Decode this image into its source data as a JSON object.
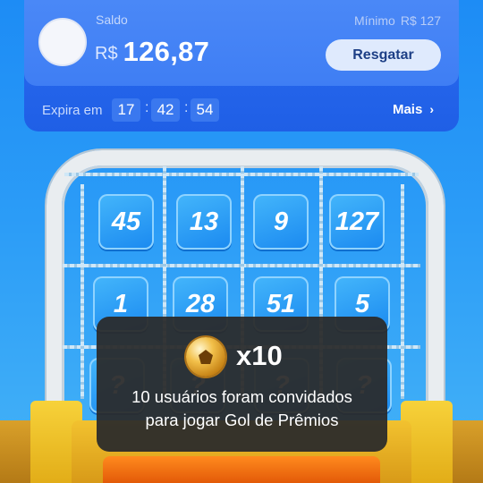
{
  "header": {
    "saldo_label": "Saldo",
    "currency": "R$",
    "balance": "126,87",
    "minimo_label": "Mínimo",
    "minimo_value": "R$ 127",
    "resgatar_label": "Resgatar",
    "expira_label": "Expira em",
    "timer": {
      "hours": "17",
      "minutes": "42",
      "seconds": "54"
    },
    "mais_label": "Mais",
    "mais_icon": "chevron-right-icon"
  },
  "grid": {
    "rows": [
      [
        "45",
        "13",
        "9",
        "127"
      ],
      [
        "1",
        "28",
        "51",
        "5"
      ],
      [
        "?",
        "?",
        "?",
        "?"
      ]
    ]
  },
  "toast": {
    "icon": "golden-soccer-ball-icon",
    "count": "x10",
    "message_line1": "10 usuários foram convidados",
    "message_line2": "para jogar Gol de Prêmios"
  },
  "colors": {
    "background": "#2b9cf7",
    "card": "#3f7ef4",
    "button": "#dfeafd",
    "cell": "#1a89f0",
    "toast": "#2a2a2a",
    "base": "#f2c22f"
  }
}
